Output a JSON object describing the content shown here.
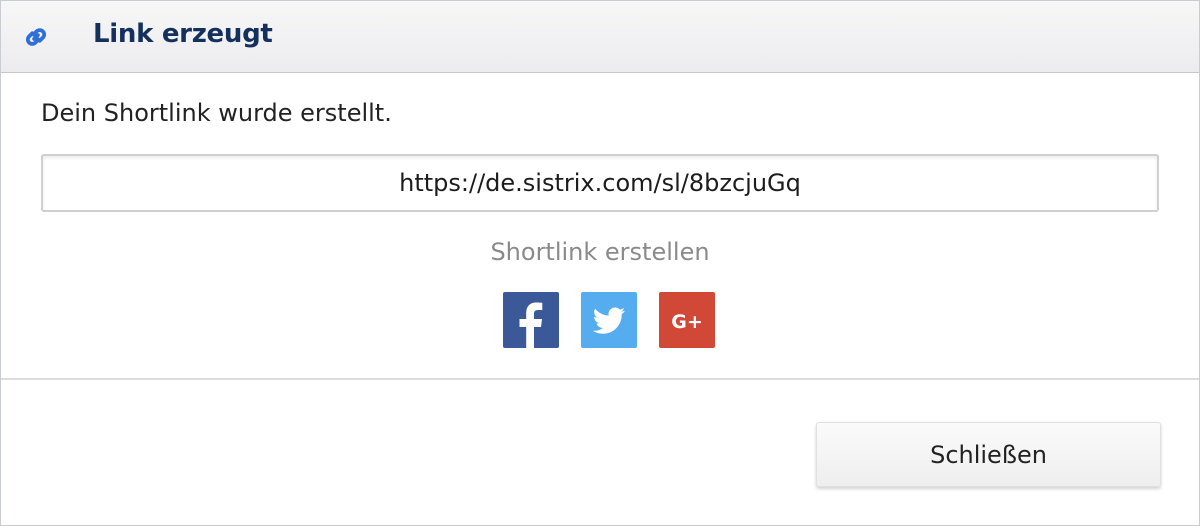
{
  "dialog": {
    "title": "Link erzeugt",
    "title_icon": "link-icon",
    "message": "Dein Shortlink wurde erstellt.",
    "shortlink_value": "https://de.sistrix.com/sl/8bzcjuGq",
    "share_label": "Shortlink erstellen",
    "share_buttons": [
      {
        "icon": "facebook-icon",
        "color": "#3b5998"
      },
      {
        "icon": "twitter-icon",
        "color": "#55acee"
      },
      {
        "icon": "google-plus-icon",
        "color": "#d14836",
        "glyph": "G+"
      }
    ],
    "close_label": "Schließen"
  },
  "colors": {
    "title": "#14305c",
    "link_icon": "#2f6fd6"
  }
}
